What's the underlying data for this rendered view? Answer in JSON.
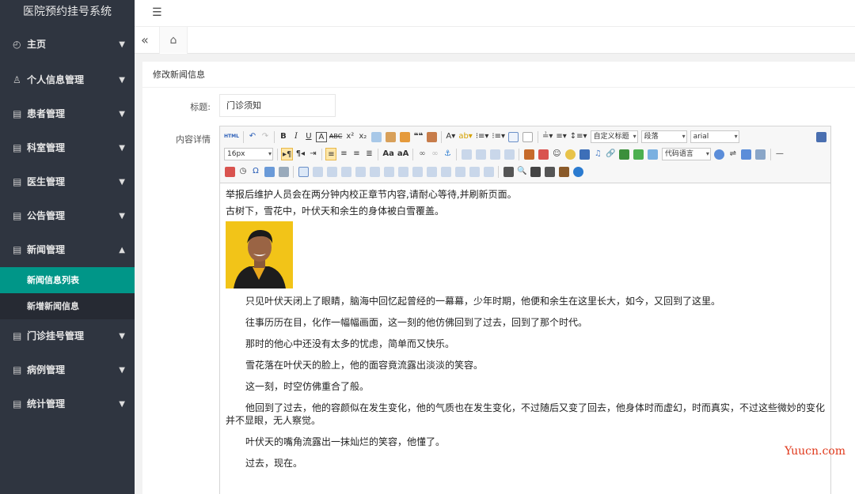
{
  "app": {
    "title": "医院预约挂号系统"
  },
  "sidebar": {
    "items": [
      {
        "label": "主页",
        "icon": "dashboard-icon",
        "expanded": false
      },
      {
        "label": "个人信息管理",
        "icon": "user-icon",
        "expanded": false
      },
      {
        "label": "患者管理",
        "icon": "document-icon",
        "expanded": false
      },
      {
        "label": "科室管理",
        "icon": "document-icon",
        "expanded": false
      },
      {
        "label": "医生管理",
        "icon": "document-icon",
        "expanded": false
      },
      {
        "label": "公告管理",
        "icon": "document-icon",
        "expanded": false
      },
      {
        "label": "新闻管理",
        "icon": "document-icon",
        "expanded": true
      },
      {
        "label": "门诊挂号管理",
        "icon": "document-icon",
        "expanded": false
      },
      {
        "label": "病例管理",
        "icon": "document-icon",
        "expanded": false
      },
      {
        "label": "统计管理",
        "icon": "document-icon",
        "expanded": false
      }
    ],
    "news_sub": [
      {
        "label": "新闻信息列表",
        "active": true
      },
      {
        "label": "新增新闻信息",
        "active": false
      }
    ],
    "active_color": "#009688"
  },
  "form": {
    "heading": "修改新闻信息",
    "title_label": "标题:",
    "title_value": "门诊须知",
    "content_label": "内容详情"
  },
  "editor": {
    "toolbar": {
      "custom_title": "自定义标题",
      "paragraph": "段落",
      "font_family": "arial",
      "font_size": "16px",
      "code_lang": "代码语言"
    },
    "content": {
      "line1": "举报后维护人员会在两分钟内校正章节内容,请耐心等待,并刷新页面。",
      "line2": "古树下，雪花中，叶伏天和余生的身体被白雪覆盖。",
      "paragraphs": [
        "只见叶伏天闭上了眼睛，脑海中回忆起曾经的一幕幕，少年时期，他便和余生在这里长大，如今，又回到了这里。",
        "往事历历在目，化作一幅幅画面，这一刻的他仿佛回到了过去，回到了那个时代。",
        "那时的他心中还没有太多的忧虑，简单而又快乐。",
        "雪花落在叶伏天的脸上，他的面容竟流露出淡淡的笑容。",
        "这一刻，时空仿佛重合了般。",
        "他回到了过去，他的容颜似在发生变化，他的气质也在发生变化，不过随后又变了回去，他身体时而虚幻，时而真实，不过这些微妙的变化并不显眼，无人察觉。",
        "叶伏天的嘴角流露出一抹灿烂的笑容，他懂了。",
        "过去，现在。"
      ]
    }
  },
  "watermark": "Yuucn.com"
}
